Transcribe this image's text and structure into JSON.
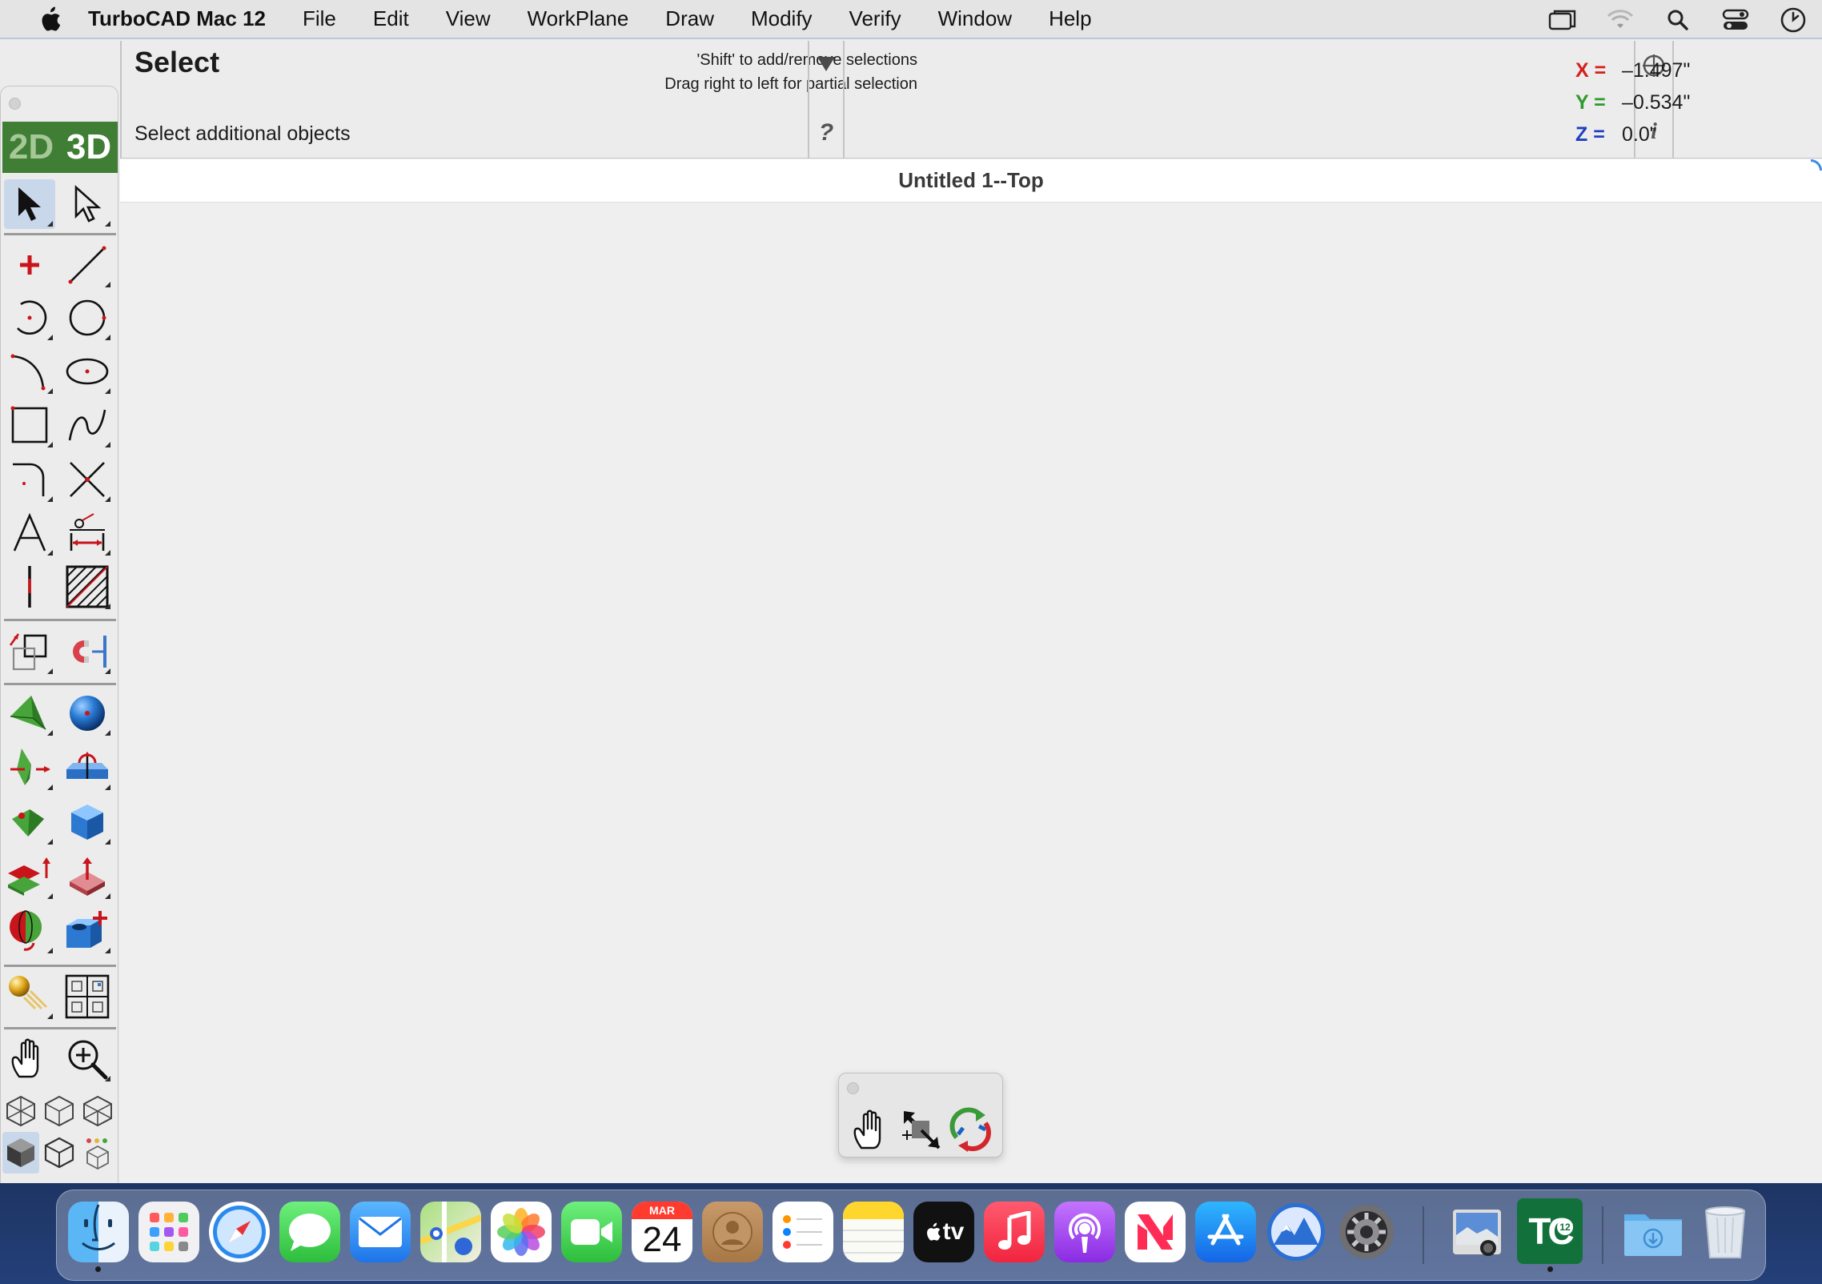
{
  "menubar": {
    "app_name": "TurboCAD Mac 12",
    "items": [
      "File",
      "Edit",
      "View",
      "WorkPlane",
      "Draw",
      "Modify",
      "Verify",
      "Window",
      "Help"
    ],
    "status_icons": [
      "window-icon",
      "wifi-icon",
      "spotlight-search-icon",
      "control-center-icon",
      "clock-icon"
    ]
  },
  "inspector": {
    "tool_title": "Select",
    "hint": "Select additional objects",
    "tip_line1": "'Shift' to add/remove selections",
    "tip_line2": "Drag right to left for partial selection",
    "help_label": "?",
    "info_label": "i",
    "coords": {
      "x_label": "X =",
      "x_value": "–1.497\"",
      "y_label": "Y =",
      "y_value": "–0.534\"",
      "z_label": "Z =",
      "z_value": "0.0\"",
      "x_color": "#d4201c",
      "y_color": "#2f9a2c",
      "z_color": "#1f3fbf"
    }
  },
  "document": {
    "title": "Untitled 1--Top"
  },
  "toolbox": {
    "mode_2d": "2D",
    "mode_3d": "3D",
    "accent_green": "#3f7e34"
  },
  "dock": {
    "calendar_month": "MAR",
    "calendar_day": "24",
    "tv_label": "tv",
    "turbocad_label": "TC",
    "turbocad_version": "12",
    "apps": [
      "Finder",
      "Launchpad",
      "Safari",
      "Messages",
      "Mail",
      "Maps",
      "Photos",
      "FaceTime",
      "Calendar",
      "Contacts",
      "Reminders",
      "Notes",
      "TV",
      "Music",
      "Podcasts",
      "News",
      "App Store",
      "Monterey",
      "System Preferences",
      "Preview",
      "TurboCAD Mac 12",
      "Downloads",
      "Trash"
    ]
  }
}
